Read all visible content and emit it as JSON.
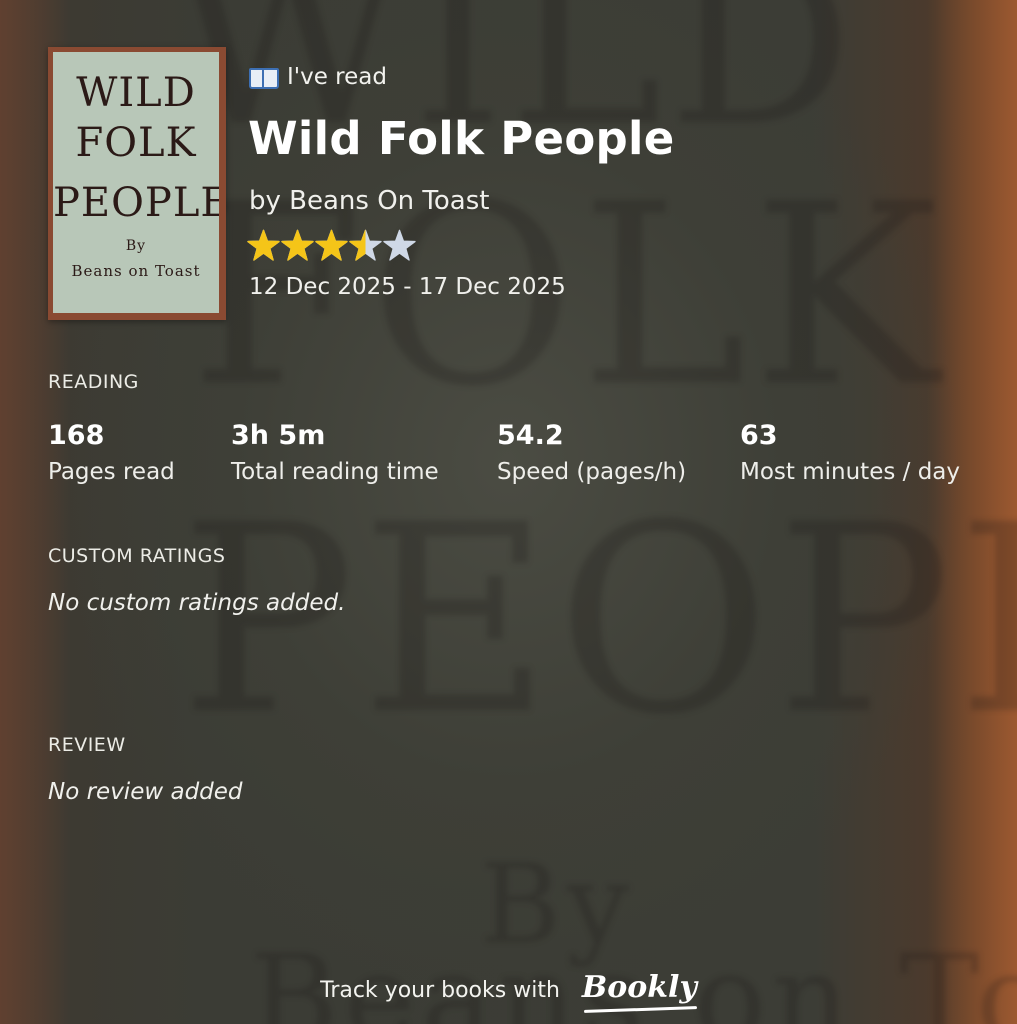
{
  "cover": {
    "lines": [
      "WILD",
      "FOLK",
      "PEOPLE",
      "By",
      "Beans on Toast"
    ]
  },
  "header": {
    "status_icon": "open-book-icon",
    "status_text": "I've read",
    "title": "Wild Folk People",
    "author": "by Beans On Toast",
    "rating": {
      "value": 3.5,
      "max": 5,
      "filled_color": "#f5c518",
      "empty_color": "#cfd8e6"
    },
    "dates": "12 Dec 2025 - 17 Dec 2025"
  },
  "reading": {
    "label": "READING",
    "stats": [
      {
        "value": "168",
        "label": "Pages read"
      },
      {
        "value": "3h 5m",
        "label": "Total reading time"
      },
      {
        "value": "54.2",
        "label": "Speed (pages/h)"
      },
      {
        "value": "63",
        "label": "Most minutes / day"
      }
    ]
  },
  "custom_ratings": {
    "label": "CUSTOM RATINGS",
    "empty_text": "No custom ratings added."
  },
  "review": {
    "label": "REVIEW",
    "empty_text": "No review added"
  },
  "footer": {
    "text": "Track your books with",
    "brand": "Bookly"
  }
}
